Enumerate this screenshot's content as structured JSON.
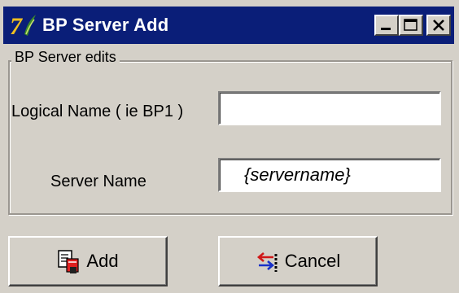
{
  "window": {
    "title": "BP Server Add"
  },
  "titlebar_buttons": {
    "minimize_icon": "minimize-icon",
    "maximize_icon": "maximize-icon",
    "close_icon": "close-icon"
  },
  "group": {
    "legend": "BP Server edits"
  },
  "fields": {
    "logical_name_label": "Logical Name ( ie BP1 )",
    "logical_name_value": "",
    "server_name_label": "Server Name",
    "server_name_value": "{servername}"
  },
  "buttons": {
    "add_label": "Add",
    "add_icon": "add-document-icon",
    "cancel_label": "Cancel",
    "cancel_icon": "cancel-arrows-icon"
  },
  "colors": {
    "titlebar": "#0a1e78",
    "window_bg": "#d4d0c8"
  }
}
